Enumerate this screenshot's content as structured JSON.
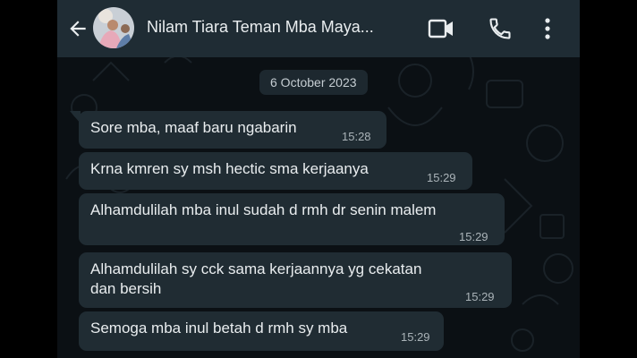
{
  "header": {
    "contact_name": "Nilam Tiara Teman Mba Maya...",
    "icons": [
      "back-arrow-icon",
      "video-call-icon",
      "phone-icon",
      "more-vert-icon"
    ]
  },
  "chat": {
    "date_label": "6 October 2023",
    "messages": [
      {
        "text": "Sore mba, maaf baru ngabarin",
        "time": "15:28"
      },
      {
        "text": "Krna kmren sy msh hectic sma kerjaanya",
        "time": "15:29"
      },
      {
        "text": "Alhamdulilah mba inul sudah d rmh dr senin malem",
        "time": "15:29"
      },
      {
        "text": "Alhamdulilah sy cck sama kerjaannya yg cekatan\ndan bersih",
        "time": "15:29"
      },
      {
        "text": "Semoga mba inul betah d rmh sy mba",
        "time": "15:29"
      }
    ]
  },
  "colors": {
    "header_bg": "#1f2c34",
    "chat_bg": "#0b1014",
    "bubble_bg": "#202c33",
    "text": "#e9edef",
    "meta_text": "#aab3b8"
  }
}
